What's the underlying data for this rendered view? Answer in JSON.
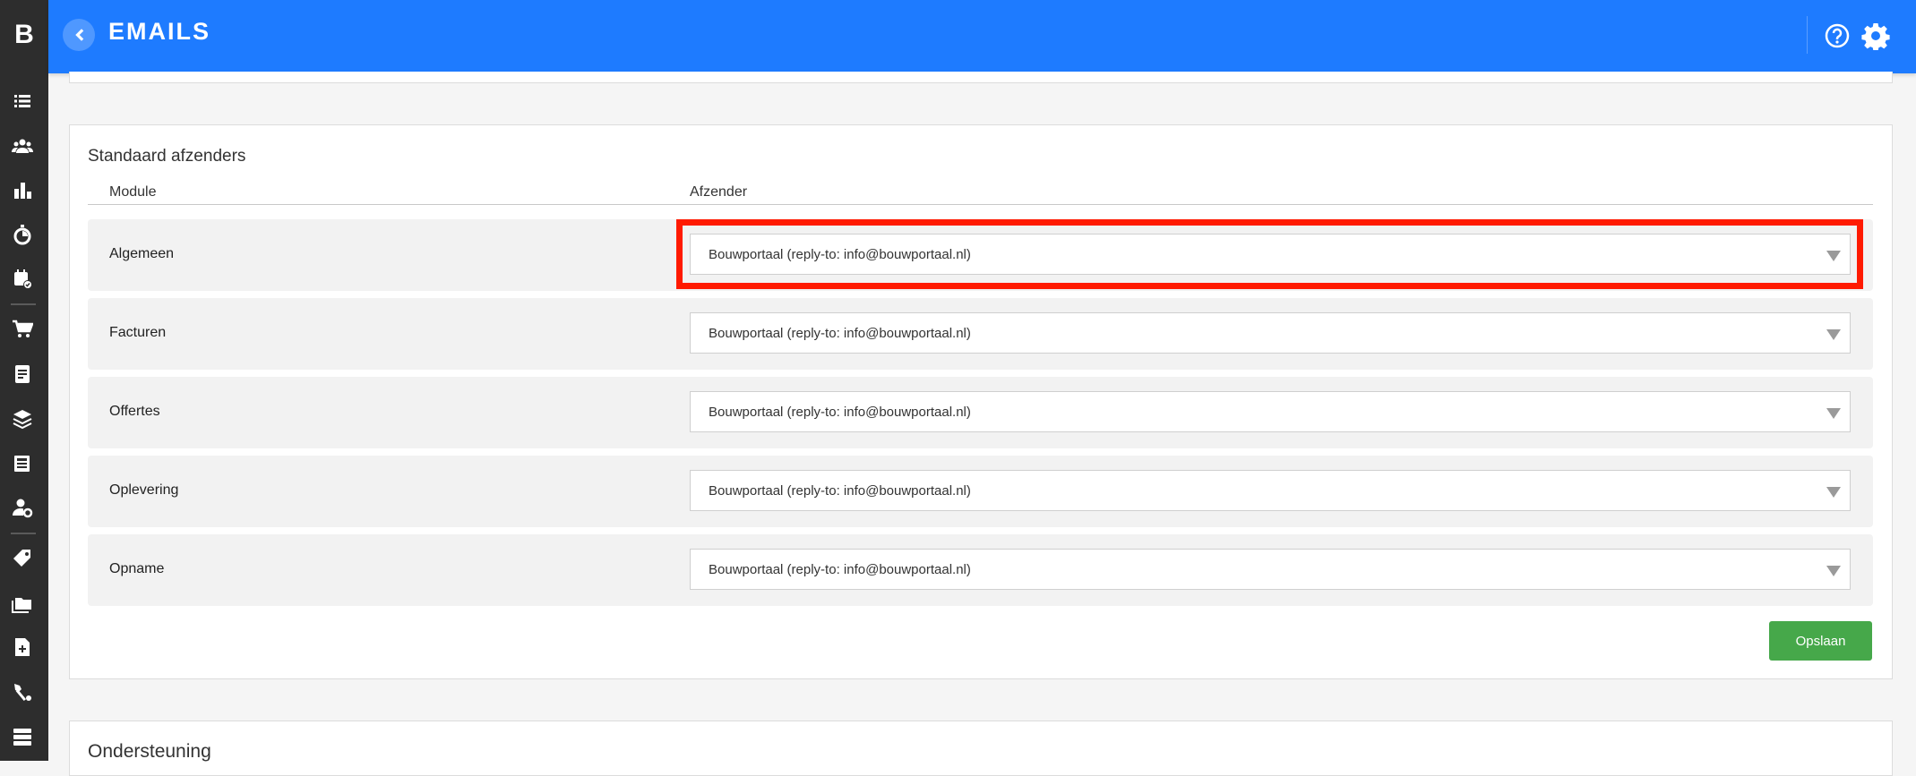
{
  "app": {
    "logo_letter": "B"
  },
  "header": {
    "title": "EMAILS"
  },
  "sidebar": {
    "icons": [
      "list-icon",
      "users-icon",
      "bar-chart-icon",
      "stopwatch-icon",
      "calendar-check-icon",
      "cart-icon",
      "document-icon",
      "layers-icon",
      "newspaper-icon",
      "user-cog-icon",
      "tag-icon",
      "folders-icon",
      "file-plus-icon",
      "tools-icon",
      "server-icon"
    ]
  },
  "senders_section": {
    "title": "Standaard afzenders",
    "col_module": "Module",
    "col_sender": "Afzender",
    "rows": [
      {
        "module": "Algemeen",
        "sender": "Bouwportaal (reply-to: info@bouwportaal.nl)"
      },
      {
        "module": "Facturen",
        "sender": "Bouwportaal (reply-to: info@bouwportaal.nl)"
      },
      {
        "module": "Offertes",
        "sender": "Bouwportaal (reply-to: info@bouwportaal.nl)"
      },
      {
        "module": "Oplevering",
        "sender": "Bouwportaal (reply-to: info@bouwportaal.nl)"
      },
      {
        "module": "Opname",
        "sender": "Bouwportaal (reply-to: info@bouwportaal.nl)"
      }
    ],
    "save_label": "Opslaan"
  },
  "support_section": {
    "title": "Ondersteuning"
  },
  "colors": {
    "header_blue": "#1e7bff",
    "sidebar_dark": "#2d2d2d",
    "save_green": "#46a84a",
    "highlight_red": "#ff1a00"
  }
}
